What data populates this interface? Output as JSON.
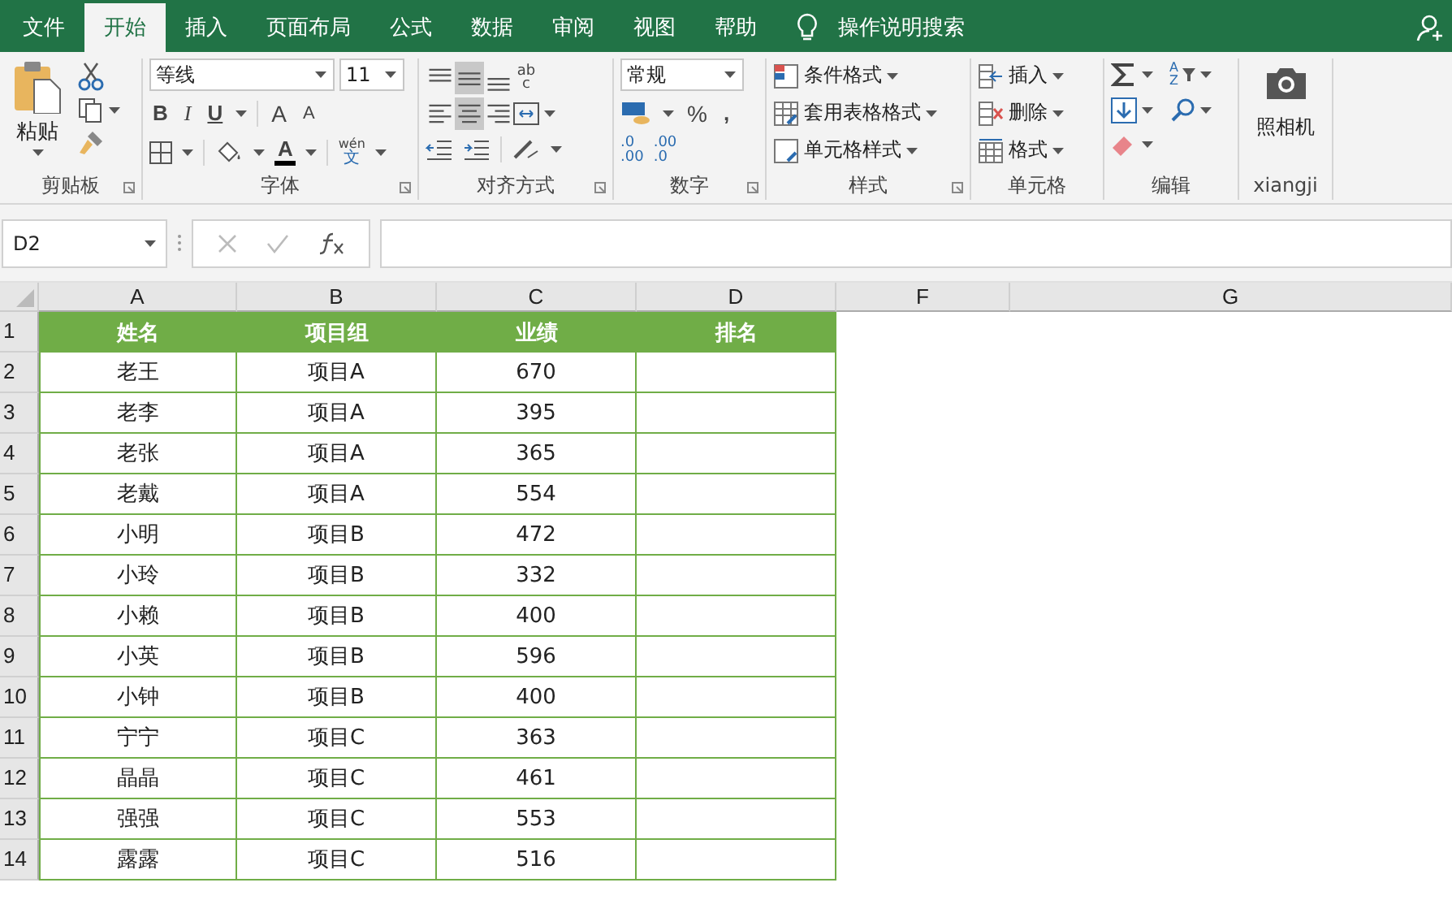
{
  "tabs": [
    {
      "label": "文件",
      "selected": false
    },
    {
      "label": "开始",
      "selected": true
    },
    {
      "label": "插入",
      "selected": false
    },
    {
      "label": "页面布局",
      "selected": false
    },
    {
      "label": "公式",
      "selected": false
    },
    {
      "label": "数据",
      "selected": false
    },
    {
      "label": "审阅",
      "selected": false
    },
    {
      "label": "视图",
      "selected": false
    },
    {
      "label": "帮助",
      "selected": false
    }
  ],
  "tell_me": "操作说明搜索",
  "clipboard": {
    "paste": "粘贴",
    "label": "剪贴板"
  },
  "font": {
    "name": "等线",
    "size": "11",
    "bold": "B",
    "italic": "I",
    "underline": "U",
    "grow": "A",
    "shrink": "A",
    "font_color": "A",
    "phonetic_top": "wén",
    "phonetic_bottom": "文",
    "label": "字体"
  },
  "alignment": {
    "wrap_top": "ab",
    "wrap_bottom": "c",
    "buttons": [
      {
        "kind": "top",
        "selected": false
      },
      {
        "kind": "middle",
        "selected": true
      },
      {
        "kind": "bottom",
        "selected": false
      },
      {
        "kind": "left",
        "selected": false
      },
      {
        "kind": "center",
        "selected": true
      },
      {
        "kind": "right",
        "selected": false
      }
    ],
    "label": "对齐方式"
  },
  "number": {
    "format": "常规",
    "percent": "%",
    "comma": ",",
    "increase_decimal": [
      ".0",
      ".00"
    ],
    "decrease_decimal": [
      ".00",
      ".0"
    ],
    "label": "数字"
  },
  "styles": {
    "items": [
      "条件格式",
      "套用表格格式",
      "单元格样式"
    ],
    "label": "样式"
  },
  "cells": {
    "items": [
      "插入",
      "删除",
      "格式"
    ],
    "label": "单元格"
  },
  "editing": {
    "sort_top": "A",
    "sort_bottom": "Z",
    "label": "编辑"
  },
  "camera": {
    "button": "照相机",
    "label": "xiangji"
  },
  "name_box": "D2",
  "columns": [
    "A",
    "B",
    "C",
    "D",
    "F",
    "G"
  ],
  "header": [
    "姓名",
    "项目组",
    "业绩",
    "排名"
  ],
  "row_numbers": [
    "1",
    "2",
    "3",
    "4",
    "5",
    "6",
    "7",
    "8",
    "9",
    "10",
    "11",
    "12",
    "13",
    "14"
  ],
  "rows": [
    [
      "老王",
      "项目A",
      "670"
    ],
    [
      "老李",
      "项目A",
      "395"
    ],
    [
      "老张",
      "项目A",
      "365"
    ],
    [
      "老戴",
      "项目A",
      "554"
    ],
    [
      "小明",
      "项目B",
      "472"
    ],
    [
      "小玲",
      "项目B",
      "332"
    ],
    [
      "小赖",
      "项目B",
      "400"
    ],
    [
      "小英",
      "项目B",
      "596"
    ],
    [
      "小钟",
      "项目B",
      "400"
    ],
    [
      "宁宁",
      "项目C",
      "363"
    ],
    [
      "晶晶",
      "项目C",
      "461"
    ],
    [
      "强强",
      "项目C",
      "553"
    ],
    [
      "露露",
      "项目C",
      "516"
    ]
  ]
}
